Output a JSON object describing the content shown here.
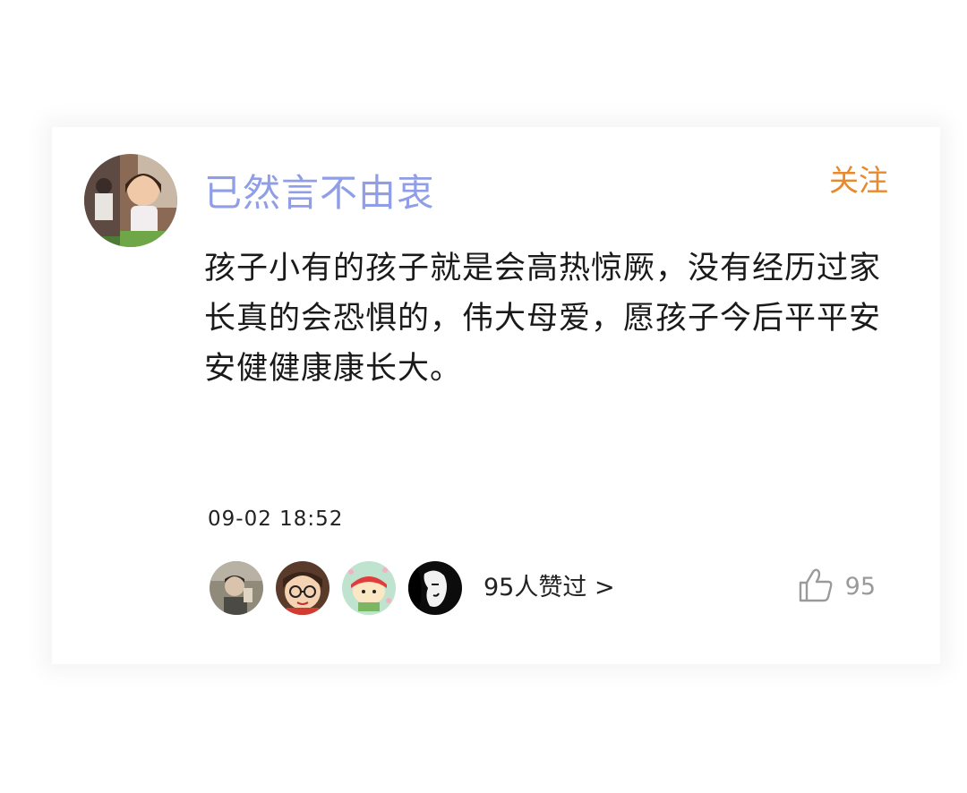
{
  "comment": {
    "username": "已然言不由衷",
    "follow_label": "关注",
    "text": "孩子小有的孩子就是会高热惊厥，没有经历过家长真的会恐惧的，伟大母爱，愿孩子今后平平安安健健康康长大。",
    "timestamp": "09-02  18:52",
    "likes_summary": "95人赞过 >",
    "like_count": "95",
    "avatar_icon": "user-avatar-photo",
    "like_icon": "thumbs-up-icon"
  },
  "colors": {
    "username": "#8f9ee6",
    "follow": "#e8892c",
    "text": "#1a1a1a",
    "muted": "#9a9a9a"
  }
}
